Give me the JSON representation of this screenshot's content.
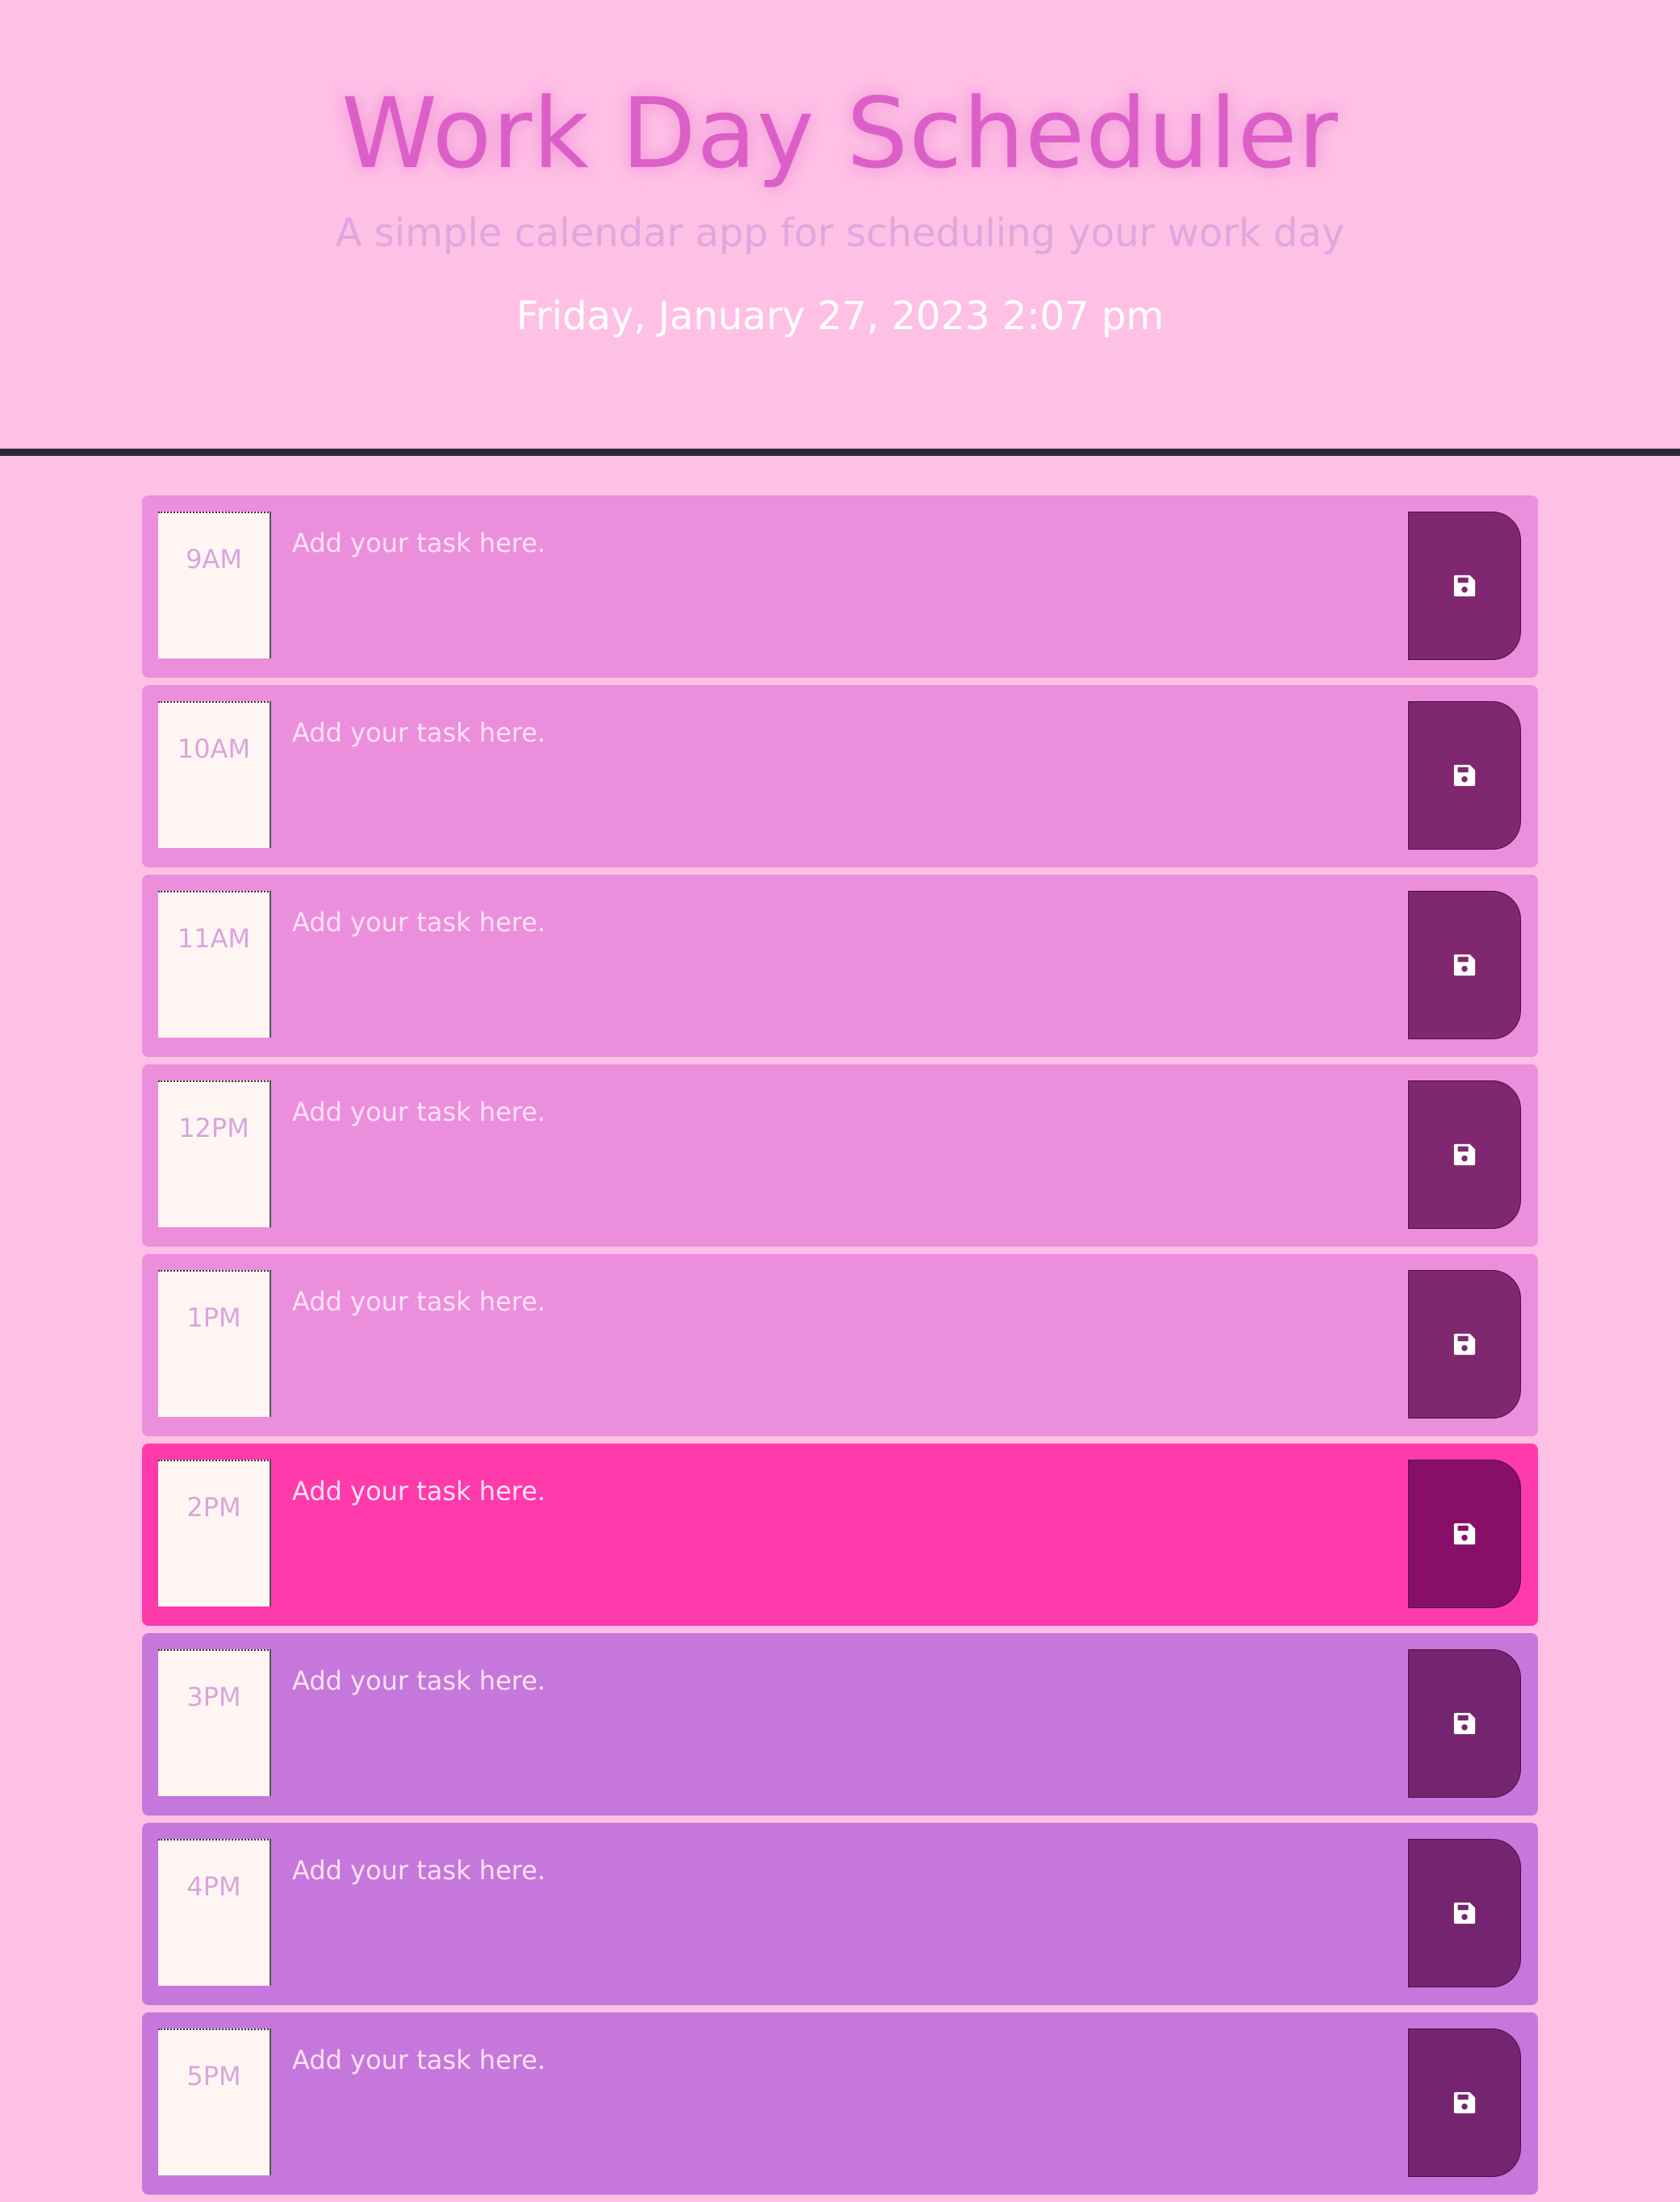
{
  "header": {
    "title": "Work Day Scheduler",
    "subtitle": "A simple calendar app for scheduling your work day",
    "current_datetime": "Friday, January 27, 2023 2:07 pm"
  },
  "colors": {
    "page_background": "#ffc0e6",
    "past_row": "#eb8fdc",
    "present_row": "#ff3aaa",
    "future_row": "#c577dc",
    "hour_box": "#fff6f3",
    "save_button_past": "#7f2870",
    "save_button_present": "#880f68",
    "save_button_future": "#752570",
    "divider": "#2a2a36"
  },
  "task_placeholder": "Add your task here.",
  "save_icon": "floppy-disk-icon",
  "time_blocks": [
    {
      "hour": "9AM",
      "state": "past",
      "task": ""
    },
    {
      "hour": "10AM",
      "state": "past",
      "task": ""
    },
    {
      "hour": "11AM",
      "state": "past",
      "task": ""
    },
    {
      "hour": "12PM",
      "state": "past",
      "task": ""
    },
    {
      "hour": "1PM",
      "state": "past",
      "task": ""
    },
    {
      "hour": "2PM",
      "state": "present",
      "task": ""
    },
    {
      "hour": "3PM",
      "state": "future",
      "task": ""
    },
    {
      "hour": "4PM",
      "state": "future",
      "task": ""
    },
    {
      "hour": "5PM",
      "state": "future",
      "task": ""
    }
  ]
}
